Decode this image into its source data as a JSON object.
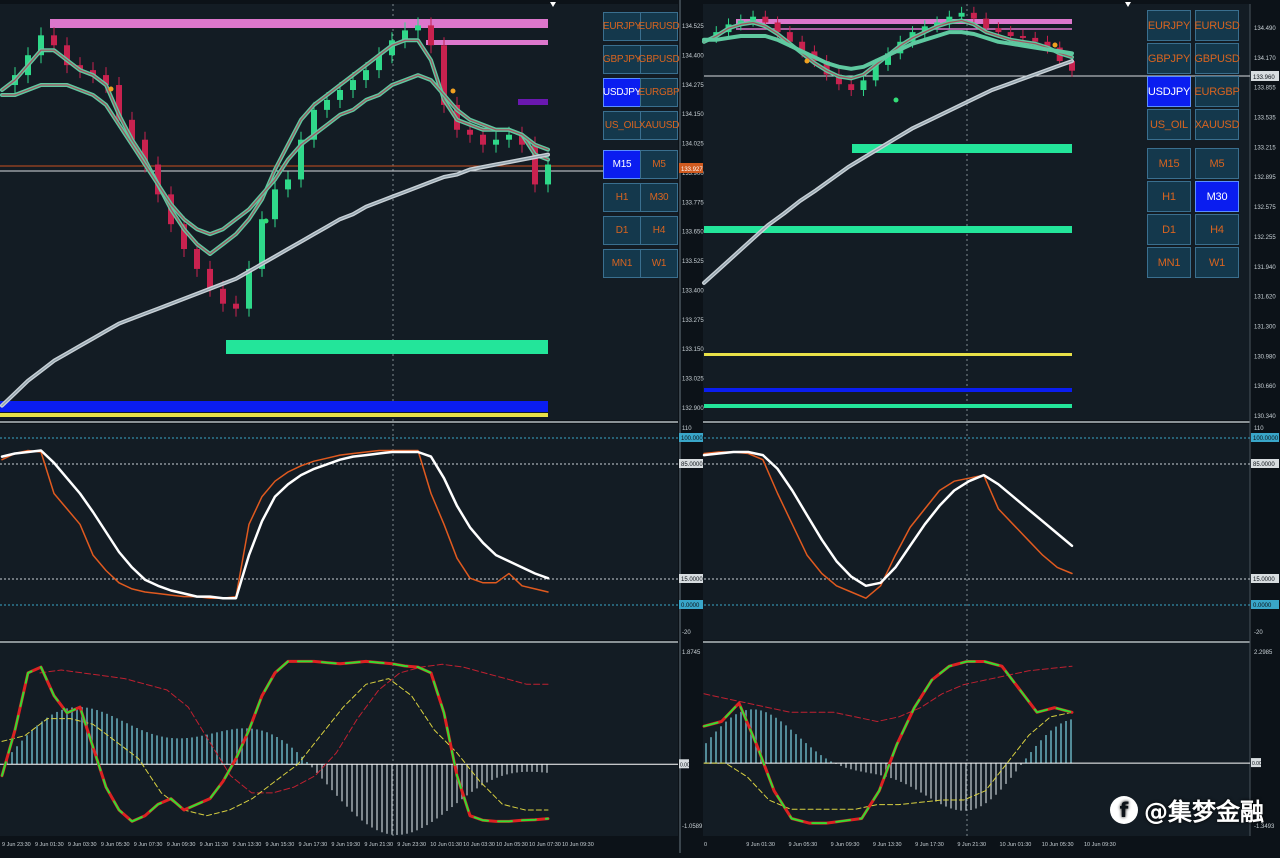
{
  "watermark": {
    "icon": "f",
    "text": "@集梦金融"
  },
  "left_panel": {
    "symbols": [
      {
        "label": "EURJPY",
        "active": false
      },
      {
        "label": "EURUSD",
        "active": false
      },
      {
        "label": "GBPJPY",
        "active": false
      },
      {
        "label": "GBPUSD",
        "active": false
      },
      {
        "label": "USDJPY",
        "active": true
      },
      {
        "label": "EURGBP",
        "active": false
      },
      {
        "label": "US_OIL",
        "active": false
      },
      {
        "label": "XAUUSD",
        "active": false
      }
    ],
    "timeframes": [
      {
        "label": "M15",
        "active": true
      },
      {
        "label": "M5",
        "active": false
      },
      {
        "label": "H1",
        "active": false
      },
      {
        "label": "M30",
        "active": false
      },
      {
        "label": "D1",
        "active": false
      },
      {
        "label": "H4",
        "active": false
      },
      {
        "label": "MN1",
        "active": false
      },
      {
        "label": "W1",
        "active": false
      }
    ]
  },
  "right_panel": {
    "symbols": [
      {
        "label": "EURJPY",
        "active": false
      },
      {
        "label": "EURUSD",
        "active": false
      },
      {
        "label": "GBPJPY",
        "active": false
      },
      {
        "label": "GBPUSD",
        "active": false
      },
      {
        "label": "USDJPY",
        "active": true
      },
      {
        "label": "EURGBP",
        "active": false
      },
      {
        "label": "US_OIL",
        "active": false
      },
      {
        "label": "XAUUSD",
        "active": false
      }
    ],
    "timeframes": [
      {
        "label": "M15",
        "active": false
      },
      {
        "label": "M5",
        "active": false
      },
      {
        "label": "H1",
        "active": false
      },
      {
        "label": "M30",
        "active": true
      },
      {
        "label": "D1",
        "active": false
      },
      {
        "label": "H4",
        "active": false
      },
      {
        "label": "MN1",
        "active": false
      },
      {
        "label": "W1",
        "active": false
      }
    ]
  },
  "chart_data": [
    {
      "type": "line",
      "name": "USDJPY M15 price",
      "y_ticks": [
        "134.525",
        "134.400",
        "134.275",
        "134.150",
        "134.025",
        "133.900",
        "133.775",
        "133.650",
        "133.525",
        "133.400",
        "133.275",
        "133.150",
        "133.025",
        "132.900"
      ],
      "ylim": [
        132.9,
        134.55
      ],
      "current_price": "133.927",
      "x_ticks": [
        "9 Jun 23:30",
        "9 Jun 01:30",
        "9 Jun 03:30",
        "9 Jun 05:30",
        "9 Jun 07:30",
        "9 Jun 09:30",
        "9 Jun 11:30",
        "9 Jun 13:30",
        "9 Jun 15:30",
        "9 Jun 17:30",
        "9 Jun 19:30",
        "9 Jun 21:30",
        "9 Jun 23:30",
        "10 Jun 01:30",
        "10 Jun 03:30",
        "10 Jun 05:30",
        "10 Jun 07:30",
        "10 Jun 09:30"
      ],
      "close": [
        134.24,
        134.28,
        134.36,
        134.44,
        134.4,
        134.32,
        134.3,
        134.28,
        134.24,
        134.1,
        134.02,
        133.92,
        133.8,
        133.68,
        133.58,
        133.5,
        133.42,
        133.36,
        133.34,
        133.5,
        133.7,
        133.82,
        133.86,
        134.02,
        134.14,
        134.18,
        134.22,
        134.26,
        134.3,
        134.36,
        134.42,
        134.46,
        134.48,
        134.4,
        134.16,
        134.06,
        134.04,
        134.0,
        134.02,
        134.04,
        134.0,
        133.84,
        133.92
      ],
      "series": [
        {
          "name": "fast ma",
          "color": "#5fc9a0",
          "values": [
            134.22,
            134.26,
            134.32,
            134.38,
            134.38,
            134.34,
            134.3,
            134.28,
            134.24,
            134.12,
            134.02,
            133.94,
            133.84,
            133.74,
            133.66,
            133.6,
            133.56,
            133.6,
            133.64,
            133.7,
            133.78,
            133.9,
            134.0,
            134.1,
            134.16,
            134.2,
            134.24,
            134.28,
            134.32,
            134.36,
            134.4,
            134.42,
            134.42,
            134.34,
            134.18,
            134.1,
            134.08,
            134.06,
            134.06,
            134.06,
            134.04,
            133.96,
            133.94
          ]
        },
        {
          "name": "slow ma",
          "color": "#5fc9a0",
          "values": [
            134.2,
            134.2,
            134.22,
            134.24,
            134.24,
            134.24,
            134.22,
            134.2,
            134.16,
            134.08,
            134.0,
            133.92,
            133.84,
            133.76,
            133.7,
            133.66,
            133.64,
            133.66,
            133.7,
            133.74,
            133.8,
            133.86,
            133.94,
            134.0,
            134.04,
            134.08,
            134.12,
            134.14,
            134.18,
            134.2,
            134.24,
            134.26,
            134.28,
            134.26,
            134.2,
            134.14,
            134.1,
            134.08,
            134.06,
            134.06,
            134.04,
            134.0,
            133.98
          ]
        },
        {
          "name": "long ma",
          "color": "#c8d0d6",
          "values": [
            132.95,
            133.0,
            133.05,
            133.09,
            133.13,
            133.16,
            133.19,
            133.22,
            133.25,
            133.28,
            133.3,
            133.32,
            133.34,
            133.36,
            133.38,
            133.4,
            133.42,
            133.44,
            133.46,
            133.49,
            133.52,
            133.55,
            133.58,
            133.61,
            133.64,
            133.67,
            133.7,
            133.72,
            133.75,
            133.77,
            133.79,
            133.81,
            133.83,
            133.85,
            133.87,
            133.88,
            133.9,
            133.91,
            133.92,
            133.93,
            133.94,
            133.95,
            133.96
          ]
        }
      ]
    },
    {
      "type": "line",
      "name": "stochastic M15",
      "y_ticks": [
        "110",
        "100.0000",
        "85.0000",
        "15.0000",
        "0.0000",
        "-20"
      ],
      "ylim": [
        -20,
        110
      ],
      "series": [
        {
          "name": "main",
          "color": "#ffffff",
          "values": [
            94,
            96,
            97,
            98,
            90,
            80,
            70,
            58,
            45,
            32,
            22,
            14,
            10,
            7,
            5,
            3,
            3,
            2,
            2,
            30,
            52,
            68,
            76,
            82,
            86,
            89,
            92,
            94,
            95,
            96,
            97,
            97,
            97,
            94,
            80,
            62,
            48,
            38,
            30,
            26,
            22,
            18,
            15
          ]
        },
        {
          "name": "signal",
          "color": "#e05a1f",
          "values": [
            92,
            96,
            98,
            97,
            70,
            60,
            50,
            30,
            20,
            12,
            8,
            6,
            5,
            4,
            3,
            3,
            2,
            2,
            3,
            50,
            68,
            78,
            84,
            88,
            91,
            93,
            95,
            96,
            97,
            98,
            98,
            98,
            98,
            70,
            50,
            28,
            15,
            12,
            12,
            18,
            10,
            8,
            6
          ]
        }
      ]
    },
    {
      "type": "line",
      "name": "oscillator M15",
      "y_ticks": [
        "1.8745",
        "0.00",
        "-1.0589"
      ],
      "ylim": [
        -1.15,
        2.0
      ],
      "series": [
        {
          "name": "signal curve",
          "color": "#33dd33",
          "values": [
            -0.2,
            0.6,
            1.6,
            1.7,
            1.2,
            0.9,
            1.0,
            0.3,
            -0.4,
            -0.8,
            -1.0,
            -0.9,
            -0.7,
            -0.6,
            -0.8,
            -0.7,
            -0.6,
            -0.3,
            0.1,
            0.6,
            1.2,
            1.6,
            1.8,
            1.8,
            1.8,
            1.78,
            1.76,
            1.78,
            1.8,
            1.78,
            1.76,
            1.72,
            1.7,
            1.6,
            0.9,
            -0.2,
            -0.9,
            -0.98,
            -1.0,
            -1.0,
            -0.98,
            -0.97,
            -0.95
          ]
        }
      ]
    },
    {
      "type": "line",
      "name": "USDJPY M30 price",
      "y_ticks": [
        "134.490",
        "134.170",
        "133.855",
        "133.535",
        "133.215",
        "132.895",
        "132.575",
        "132.255",
        "131.940",
        "131.620",
        "131.300",
        "130.980",
        "130.660",
        "130.340"
      ],
      "ylim": [
        130.3,
        134.55
      ],
      "current_price": "133.960",
      "x_ticks": [
        "0",
        "9 Jun 01:30",
        "9 Jun 05:30",
        "9 Jun 09:30",
        "9 Jun 13:30",
        "9 Jun 17:30",
        "9 Jun 21:30",
        "10 Jun 01:30",
        "10 Jun 05:30",
        "10 Jun 09:30"
      ],
      "series": [
        {
          "name": "long ma",
          "color": "#c8d0d6",
          "values": [
            131.7,
            131.85,
            132.0,
            132.15,
            132.3,
            132.42,
            132.55,
            132.66,
            132.78,
            132.9,
            133.0,
            133.1,
            133.2,
            133.3,
            133.38,
            133.46,
            133.54,
            133.62,
            133.7,
            133.76,
            133.82,
            133.88,
            133.94,
            134.0
          ]
        }
      ]
    },
    {
      "type": "line",
      "name": "stochastic M30",
      "y_ticks": [
        "110",
        "100.0000",
        "85.0000",
        "15.0000",
        "0.0000",
        "-20"
      ],
      "ylim": [
        -20,
        110
      ]
    },
    {
      "type": "line",
      "name": "oscillator M30",
      "y_ticks": [
        "2.2985",
        "0.00",
        "-1.3493"
      ],
      "ylim": [
        -1.45,
        2.45
      ]
    }
  ]
}
